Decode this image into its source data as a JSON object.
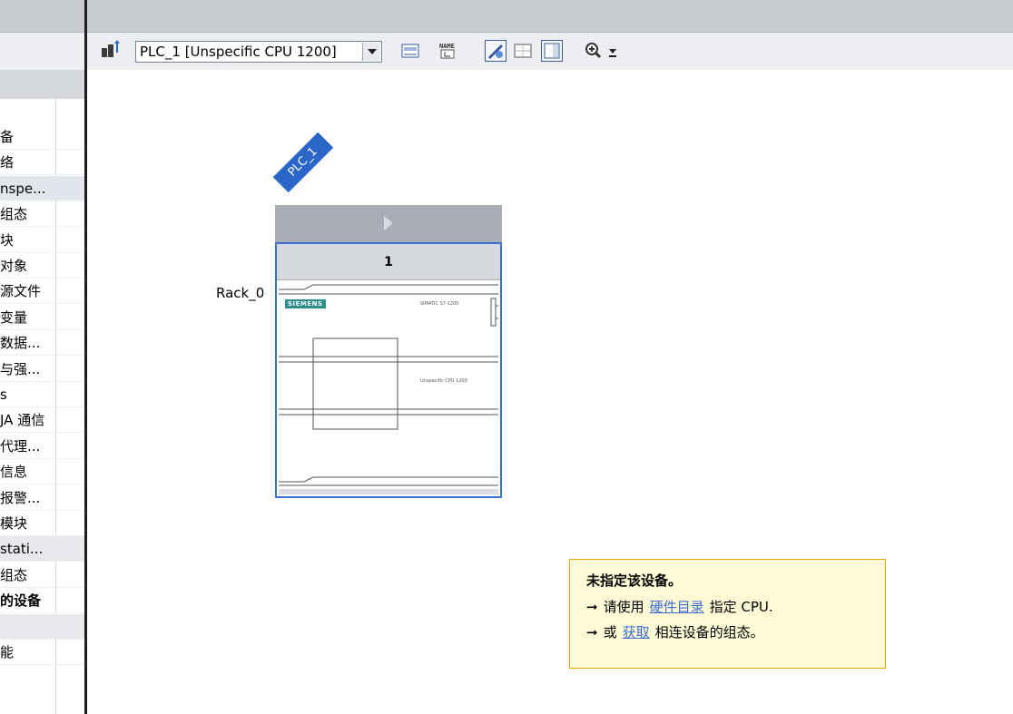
{
  "project_tree": {
    "items": [
      {
        "label": "备",
        "style": "normal"
      },
      {
        "label": "络",
        "style": "normal"
      },
      {
        "label": "nspe...",
        "style": "selected"
      },
      {
        "label": "组态",
        "style": "normal"
      },
      {
        "label": "块",
        "style": "normal"
      },
      {
        "label": "对象",
        "style": "normal"
      },
      {
        "label": "源文件",
        "style": "normal"
      },
      {
        "label": "变量",
        "style": "normal"
      },
      {
        "label": "数据...",
        "style": "normal"
      },
      {
        "label": "与强...",
        "style": "normal"
      },
      {
        "label": "s",
        "style": "normal"
      },
      {
        "label": "JA 通信",
        "style": "normal"
      },
      {
        "label": "代理...",
        "style": "normal"
      },
      {
        "label": "信息",
        "style": "normal"
      },
      {
        "label": "报警...",
        "style": "normal"
      },
      {
        "label": "模块",
        "style": "normal"
      },
      {
        "label": "stati...",
        "style": "gray"
      },
      {
        "label": "组态",
        "style": "normal"
      },
      {
        "label": "的设备",
        "style": "bold"
      },
      {
        "label": "",
        "style": "gray"
      },
      {
        "label": "能",
        "style": "normal"
      }
    ]
  },
  "toolbar": {
    "device_select": "PLC_1 [Unspecific CPU 1200]",
    "icons": [
      "network-view-icon",
      "device-list-icon",
      "name-icon",
      "properties-icon",
      "grid-icon",
      "panel-icon",
      "zoom-in-icon",
      "zoom-dropdown-icon"
    ]
  },
  "canvas": {
    "plc_tag": "PLC_1",
    "rack_label": "Rack_0",
    "slot_number": "1",
    "module_brand": "SIEMENS",
    "module_series": "SIMATIC S7-1200",
    "module_model": "Unspecific CPU 1200"
  },
  "info_box": {
    "title": "未指定该设备。",
    "line1_prefix": "请使用",
    "line1_link": "硬件目录",
    "line1_suffix": "指定 CPU.",
    "line2_prefix": "或",
    "line2_link": "获取",
    "line2_suffix": "相连设备的组态。"
  },
  "colors": {
    "selection_blue": "#3f6fd1",
    "info_border": "#f0a400",
    "info_bg": "#fffbd6",
    "link": "#3c6dd0"
  }
}
